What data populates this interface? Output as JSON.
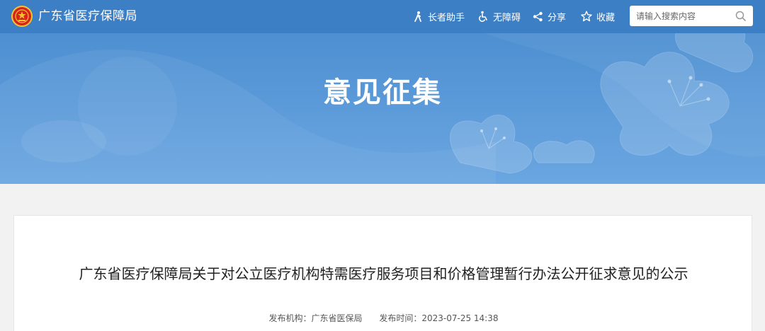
{
  "header": {
    "site_title": "广东省医疗保障局",
    "tools": {
      "elder": "长者助手",
      "accessibility": "无障碍",
      "share": "分享",
      "favorite": "收藏"
    },
    "search": {
      "placeholder": "请输入搜索内容",
      "icon": "search-icon"
    }
  },
  "banner": {
    "title": "意见征集"
  },
  "article": {
    "title": "广东省医疗保障局关于对公立医疗机构特需医疗服务项目和价格管理暂行办法公开征求意见的公示",
    "publisher": "发布机构：广东省医保局",
    "publish_time": "发布时间：2023-07-25 14:38"
  },
  "colors": {
    "header_bg": "#3d7fc4",
    "banner_bg": "#5f9ddb",
    "page_bg": "#f2f2f2"
  }
}
